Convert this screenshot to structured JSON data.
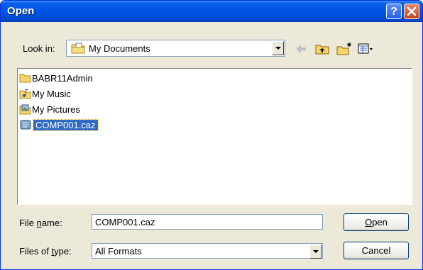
{
  "window": {
    "title": "Open",
    "help_label": "?",
    "colors": {
      "titlebar": "#0054e3",
      "face": "#ece9d8",
      "selection": "#316ac5"
    }
  },
  "toolbar": {
    "lookin_label": "Look in:",
    "lookin_value": "My Documents",
    "icons": [
      "back-arrow-icon",
      "up-folder-icon",
      "new-folder-icon",
      "views-menu-icon"
    ]
  },
  "files": [
    {
      "name": "BABR11Admin",
      "icon": "folder-icon",
      "selected": false
    },
    {
      "name": "My Music",
      "icon": "music-folder-icon",
      "selected": false
    },
    {
      "name": "My Pictures",
      "icon": "pictures-folder-icon",
      "selected": false
    },
    {
      "name": "COMP001.caz",
      "icon": "document-icon",
      "selected": true
    }
  ],
  "filename": {
    "label": "File name:",
    "value": "COMP001.caz"
  },
  "filetype": {
    "label": "Files of type:",
    "value": "All Formats"
  },
  "buttons": {
    "open": "Open",
    "cancel": "Cancel"
  }
}
